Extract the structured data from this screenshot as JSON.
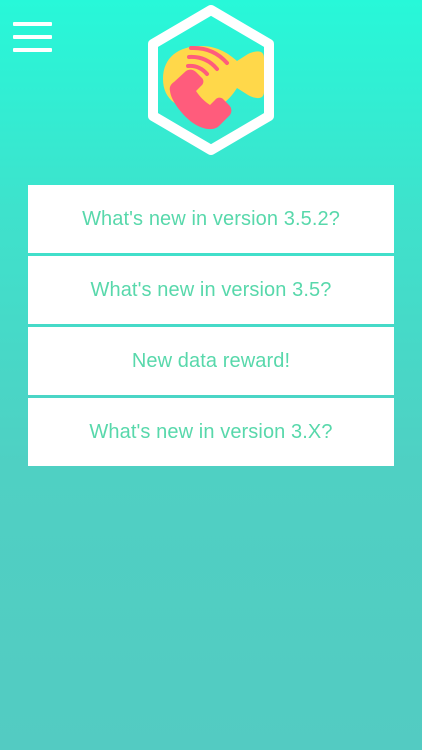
{
  "header": {
    "menu_icon": "hamburger-menu-icon",
    "logo_icon": "hexagon-phone-video-logo",
    "colors": {
      "hexagon_outline": "#ffffff",
      "bubble": "#ffd84a",
      "phone": "#ff5c7c"
    }
  },
  "menu": {
    "items": [
      {
        "label": "What's new in version 3.5.2?"
      },
      {
        "label": "What's new in version 3.5?"
      },
      {
        "label": "New data reward!"
      },
      {
        "label": "What's new in version 3.X?"
      }
    ]
  },
  "colors": {
    "background_top": "#27f8d9",
    "background_bottom": "#53cbc2",
    "item_background": "#ffffff",
    "item_text": "#58d8ab"
  }
}
